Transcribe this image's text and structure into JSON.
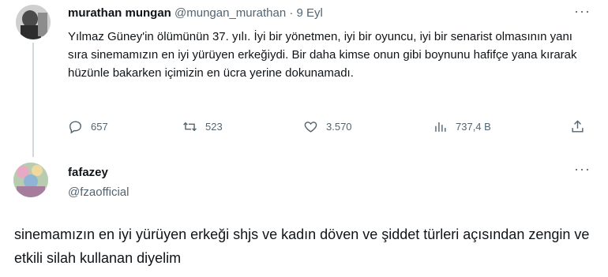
{
  "tweet": {
    "name": "murathan mungan",
    "handle": "@mungan_murathan",
    "separator": "·",
    "date": "9 Eyl",
    "more": "···",
    "text": "Yılmaz Güney'in ölümünün 37.  yılı. İyi bir yönetmen, iyi bir oyuncu, iyi bir senarist olmasının yanı sıra sinemamızın en iyi yürüyen erkeğiydi. Bir daha kimse onun gibi boynunu hafifçe yana kırarak hüzünle bakarken içimizin en ücra yerine dokunamadı.",
    "actions": {
      "replies": "657",
      "reposts": "523",
      "likes": "3.570",
      "views": "737,4 B"
    },
    "icons": {
      "reply": "reply-icon",
      "repost": "repost-icon",
      "like": "heart-icon",
      "views": "views-icon",
      "share": "share-icon"
    }
  },
  "reply": {
    "name": "fafazey",
    "handle": "@fzaofficial",
    "more": "···",
    "text": "sinemamızın en iyi yürüyen erkeği shjs ve kadın döven ve şiddet türleri açısından zengin ve etkili silah kullanan diyelim"
  },
  "colors": {
    "text": "#0f1419",
    "secondary": "#536471",
    "thread_line": "#cfd9de"
  }
}
